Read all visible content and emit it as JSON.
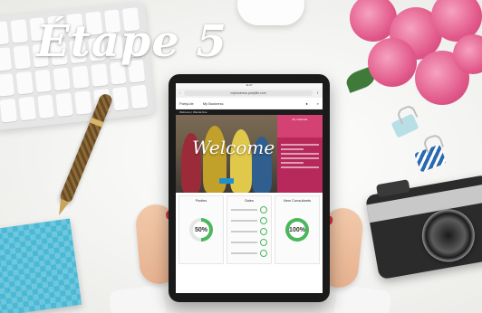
{
  "headline": "Étape 5",
  "tablet": {
    "status_time": "11:07",
    "url": "mybusiness.partylite.com",
    "brand": "PartyLite",
    "nav_label": "My Business",
    "dark_strip_text": "Welcome | Wanda Doe",
    "hero_text": "Welcome",
    "sidecard_title": "My Calendar",
    "cards": [
      {
        "title": "Parties",
        "gauge": "50%"
      },
      {
        "title": "Sales",
        "gauge": ""
      },
      {
        "title": "New Consultants",
        "gauge": "100%"
      }
    ]
  }
}
